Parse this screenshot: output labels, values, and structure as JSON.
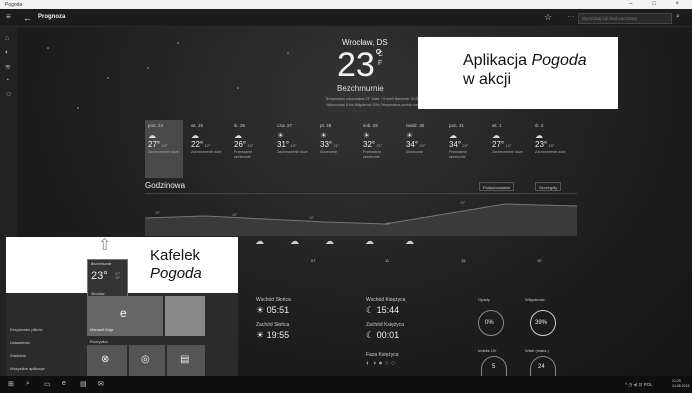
{
  "window": {
    "title": "Pogoda",
    "controls": "–  □  ×"
  },
  "nav": {
    "back_icon": "←",
    "title": "Prognoza",
    "favorite_icon": "☆",
    "more": "···",
    "search_placeholder": "Wyszukaj lub kod pocztowy",
    "search_icon": "⌕",
    "menu_icon": "≡"
  },
  "rail": {
    "items": [
      "⌂",
      "◐",
      "≋",
      "◔",
      "☺"
    ]
  },
  "current": {
    "city": "Wrocław, DS",
    "temp": "23",
    "deg": "°",
    "unit_c": "C",
    "unit_f": "F",
    "condition": "Bezchmurnie",
    "details_line1": "Temperatura odczuwalna  23°   Wiatr  ↑ 6 km/h   Barometr  1015 mbar",
    "details_line2": "Widoczność  8 km   Wilgotność  53%   Temperatura punktu rosy  13°"
  },
  "daily": [
    {
      "name": "pon. 24",
      "icon": "☁",
      "hi": "27°",
      "lo": "15°",
      "desc": "Zachmurzenie duże"
    },
    {
      "name": "wt. 25",
      "icon": "☁",
      "hi": "22°",
      "lo": "12°",
      "desc": "Zachmurzenie duże"
    },
    {
      "name": "śr. 26",
      "icon": "☁",
      "hi": "26°",
      "lo": "15°",
      "desc": "Przewaźnie słonecznie"
    },
    {
      "name": "czw. 27",
      "icon": "☀",
      "hi": "31°",
      "lo": "19°",
      "desc": "Zachmurzenie duże"
    },
    {
      "name": "pt. 28",
      "icon": "☀",
      "hi": "33°",
      "lo": "21°",
      "desc": "Słonecznie"
    },
    {
      "name": "sob. 29",
      "icon": "☀",
      "hi": "32°",
      "lo": "21°",
      "desc": "Przewaźnie słonecznie"
    },
    {
      "name": "niedz. 30",
      "icon": "☀",
      "hi": "34°",
      "lo": "20°",
      "desc": "Słonecznie"
    },
    {
      "name": "pon. 31",
      "icon": "☁",
      "hi": "34°",
      "lo": "20°",
      "desc": "Przewaźnie słonecznie"
    },
    {
      "name": "wt. 1",
      "icon": "☁",
      "hi": "27°",
      "lo": "19°",
      "desc": "Zachmurzenie duże"
    },
    {
      "name": "śr. 2",
      "icon": "☁",
      "hi": "23°",
      "lo": "15°",
      "desc": "Zachmurzenie duże"
    }
  ],
  "hourly": {
    "title": "Godzinowa",
    "summary_btn": "Podsumowanie",
    "details_btn": "Szczegóły",
    "temps": [
      "20°",
      "18°",
      "16°",
      "15°",
      "21°",
      "25°"
    ],
    "times": [
      "07",
      "11",
      "15",
      "19"
    ]
  },
  "sun": {
    "sunrise_label": "Wschód Słońca",
    "sunrise": "05:51",
    "sunset_label": "Zachód Słońca",
    "sunset": "19:55",
    "moonrise_label": "Wschód Księżyca",
    "moonrise": "15:44",
    "moonset_label": "Zachód Księżyca",
    "moonset": "00:01",
    "phase_label": "Faza Księżyca"
  },
  "metrics": {
    "precip_label": "Opady",
    "precip": "0%",
    "humidity_label": "Wilgotność",
    "humidity": "39%",
    "uv_label": "Indeks UV",
    "uv": "5",
    "wind_label": "Wiatr (maks.)",
    "wind": "24"
  },
  "overlays": {
    "app_line1": "Aplikacja ",
    "app_italic": "Pogoda",
    "app_line2": "w akcji",
    "tile_line1": "Kafelek",
    "tile_line2": "Pogoda"
  },
  "start": {
    "tile_weather_title": "Bezchmurnie",
    "tile_weather_temp": "23°",
    "tile_weather_hi": "27°",
    "tile_weather_lo": "15°",
    "tile_weather_city": "Wrocław",
    "tile_edge": "Microsoft Edge",
    "tile_rozrywka": "Rozrywka",
    "items": [
      "Eksplorator plików",
      "Ustawienia",
      "Zasilanie",
      "Wszystkie aplikacje"
    ]
  },
  "taskbar": {
    "start_icon": "⊞",
    "icons": [
      "⌕",
      "▭",
      "e",
      "▤",
      "✉"
    ],
    "tray": "^ ◷ ◂) ⊡ POL",
    "time": "21:29",
    "date": "24.08.2015"
  }
}
